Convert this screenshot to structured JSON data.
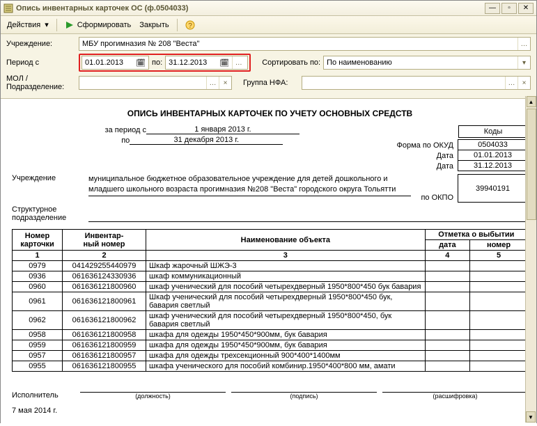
{
  "window": {
    "title": "Опись инвентарных карточек ОС (ф.0504033)"
  },
  "toolbar": {
    "actions": "Действия",
    "form": "Сформировать",
    "close": "Закрыть"
  },
  "filters": {
    "inst_label": "Учреждение:",
    "inst_value": "МБУ прогимназия № 208 \"Веста\"",
    "period_label": "Период с",
    "date_from": "01.01.2013",
    "date_to_label": "по:",
    "date_to": "31.12.2013",
    "sort_label": "Сортировать по:",
    "sort_value": "По наименованию",
    "mol_label": "МОЛ / Подразделение:",
    "group_label": "Группа НФА:"
  },
  "report": {
    "title": "ОПИСЬ ИНВЕНТАРНЫХ КАРТОЧЕК ПО УЧЕТУ ОСНОВНЫХ СРЕДСТВ",
    "codes_label": "Коды",
    "okud_label": "Форма по ОКУД",
    "okud": "0504033",
    "date_from_label": "Дата",
    "date_from": "01.01.2013",
    "date_to": "31.12.2013",
    "period_prefix": "за период с",
    "period_from": "1 января 2013 г.",
    "period_to_prefix": "по",
    "period_to": "31 декабря 2013 г.",
    "inst_row_label": "Учреждение",
    "inst_full": "муниципальное бюджетное образовательное учреждение для детей дошкольного и младшего школьного возраста прогимназия №208 \"Веста\" городского округа Тольятти",
    "okpo_label": "по ОКПО",
    "okpo": "39940191",
    "struct_label": "Структурное подразделение",
    "sig_executor": "Исполнитель",
    "sig_position": "(должность)",
    "sig_sign": "(подпись)",
    "sig_decode": "(расшифровка)",
    "footer_date": "7 мая 2014 г."
  },
  "table": {
    "h_card": "Номер карточки",
    "h_inv": "Инвентар-\nный номер",
    "h_obj": "Наименование объекта",
    "h_out": "Отметка о выбытии",
    "h_out_date": "дата",
    "h_out_num": "номер",
    "c1": "1",
    "c2": "2",
    "c3": "3",
    "c4": "4",
    "c5": "5",
    "rows": [
      {
        "card": "0979",
        "inv": "041429255440979",
        "obj": "Шкаф жарочный ШЖЭ-3"
      },
      {
        "card": "0936",
        "inv": "061636124330936",
        "obj": "шкаф коммуникационный"
      },
      {
        "card": "0960",
        "inv": "061636121800960",
        "obj": "шкаф ученический для пособий четырехдверный 1950*800*450 бук бавария"
      },
      {
        "card": "0961",
        "inv": "061636121800961",
        "obj": "Шкаф ученический для пособий четырехдверный 1950*800*450 бук, бавария светлый"
      },
      {
        "card": "0962",
        "inv": "061636121800962",
        "obj": "шкаф ученический для пособий четырехдверный 1950*800*450, бук бавария светлый"
      },
      {
        "card": "0958",
        "inv": "061636121800958",
        "obj": "шкафа для одежды 1950*450*900мм, бук бавария"
      },
      {
        "card": "0959",
        "inv": "061636121800959",
        "obj": "шкафа для одежды 1950*450*900мм, бук бавария"
      },
      {
        "card": "0957",
        "inv": "061636121800957",
        "obj": "шкафа для одежды трехсекционный 900*400*1400мм"
      },
      {
        "card": "0955",
        "inv": "061636121800955",
        "obj": "шкафа ученического для пособий комбинир.1950*400*800 мм, амати"
      }
    ]
  }
}
